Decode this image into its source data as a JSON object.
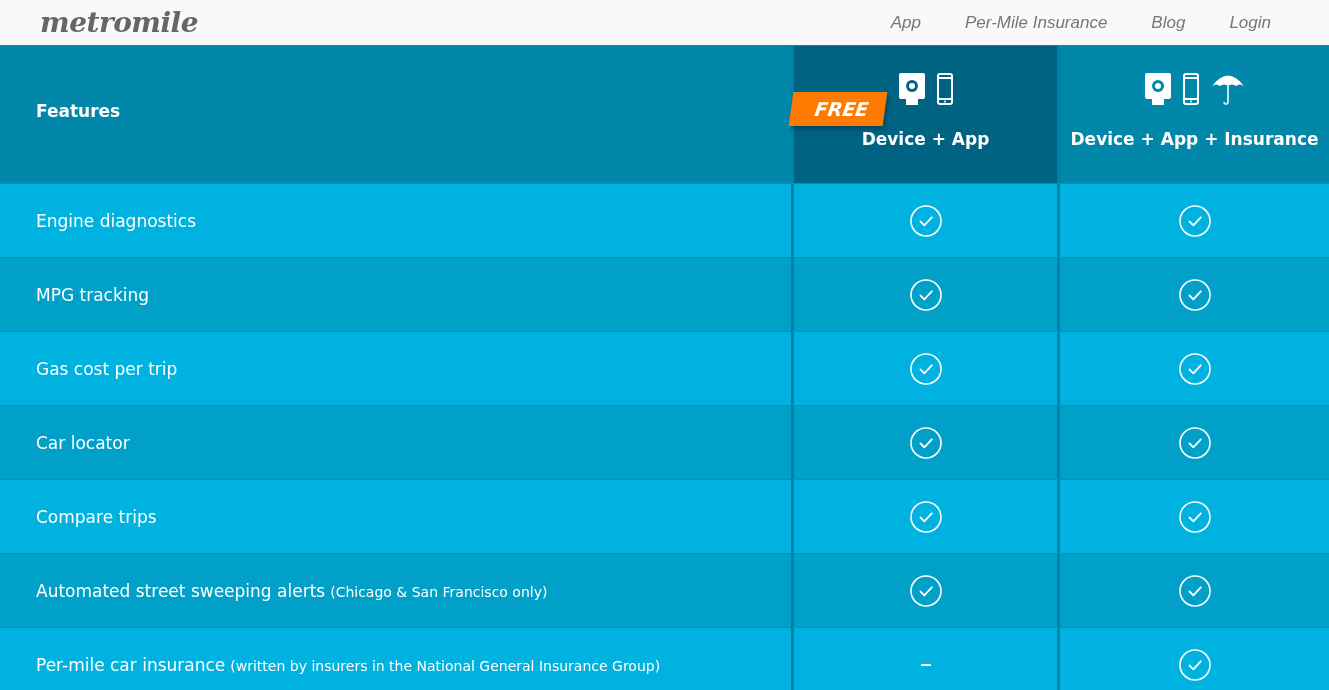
{
  "header": {
    "logo": "metromile",
    "nav": [
      "App",
      "Per-Mile Insurance",
      "Blog",
      "Login"
    ]
  },
  "table": {
    "features_heading": "Features",
    "plans": [
      {
        "name": "Device + App",
        "badge": "FREE",
        "highlighted": true,
        "icons": [
          {
            "kind": "device"
          },
          {
            "kind": "phone"
          }
        ]
      },
      {
        "name": "Device + App + Insurance",
        "highlighted": false,
        "icons": [
          {
            "kind": "device"
          },
          {
            "kind": "phone"
          },
          {
            "kind": "umbrella"
          }
        ]
      }
    ],
    "rows": [
      {
        "feature": "Engine diagnostics",
        "included": [
          true,
          true
        ]
      },
      {
        "feature": "MPG tracking",
        "included": [
          true,
          true
        ]
      },
      {
        "feature": "Gas cost per trip",
        "included": [
          true,
          true
        ]
      },
      {
        "feature": "Car locator",
        "included": [
          true,
          true
        ]
      },
      {
        "feature": "Compare trips",
        "included": [
          true,
          true
        ]
      },
      {
        "feature": "Automated street sweeping alerts",
        "note": "(Chicago & San Francisco only)",
        "included": [
          true,
          true
        ]
      },
      {
        "feature": "Per-mile car insurance",
        "note": "(written by insurers in the National General Insurance Group)",
        "included": [
          false,
          true
        ]
      }
    ]
  }
}
